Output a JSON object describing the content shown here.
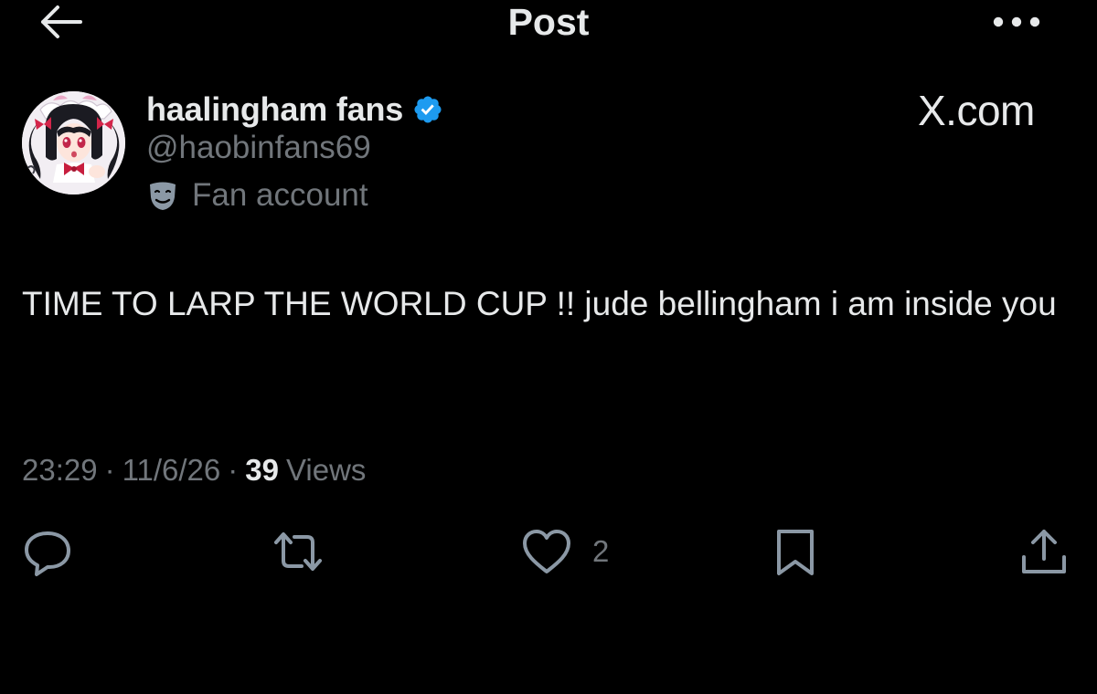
{
  "header": {
    "title": "Post",
    "back_icon": "arrow-left-icon",
    "more_icon": "more-horizontal-icon"
  },
  "author": {
    "display_name": "haalingham fans",
    "handle": "@haobinfans69",
    "verified": true,
    "verified_color": "#1d9bf0",
    "affiliation_label": "Fan account",
    "affiliation_icon": "theater-masks-icon"
  },
  "watermark": {
    "label": "X.com"
  },
  "tweet": {
    "text": "TIME TO LARP THE WORLD CUP !! jude bellingham i am inside you"
  },
  "meta": {
    "time": "23:29",
    "separator": "·",
    "date": "11/6/26",
    "views_count": "39",
    "views_label": "Views"
  },
  "actions": {
    "reply_icon": "reply-icon",
    "repost_icon": "repost-icon",
    "like_icon": "heart-icon",
    "like_count": "2",
    "bookmark_icon": "bookmark-icon",
    "share_icon": "share-icon"
  },
  "colors": {
    "background": "#000000",
    "primary_text": "#e7e9ea",
    "secondary_text": "#71767b"
  }
}
